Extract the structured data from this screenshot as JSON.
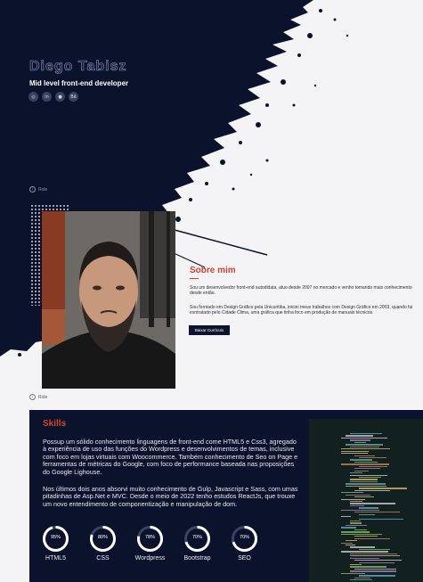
{
  "hero": {
    "name": "Diego Tabisz",
    "role": "Mid level front-end developer",
    "socials": [
      {
        "icon": "instagram-icon",
        "glyph": "◎"
      },
      {
        "icon": "linkedin-icon",
        "glyph": "in"
      },
      {
        "icon": "github-icon",
        "glyph": "●"
      },
      {
        "icon": "behance-icon",
        "glyph": "Bē"
      }
    ],
    "scroll_label": "Role",
    "scroll_glyph": "↓"
  },
  "about": {
    "title": "Sobre mim",
    "paragraph_1": "Sou um desenvolvedor front-end autodidata, atuo desde 2007 no mercado e venho tomando mais conhecimento desde então.",
    "paragraph_2": "Sou formado em Design Gráfico pela Unicuritiba, iniciei meus trabalhos com Design Gráfico em 2003, quando fui contratado pelo Cidade Clima, uma gráfica que tinha foco em produção de manuais técnicos.",
    "cv_button": "Baixar Currículo",
    "scroll_label": "Role",
    "scroll_glyph": "↓"
  },
  "skills": {
    "title": "Skills",
    "paragraph_1": "Possup um sólido conhecimento linguagens de front-end come HTML5 e Css3, agregado à experiência de uso das funções do Wordpress e desenvolvimentos de temas, inclusive com foco em lojas virtuais com Woocommerce. Também conhecimento de Seo on Page e ferramentas de métricas do Google, com foco de performance baseada nas proposições do Google Lighouse.",
    "paragraph_2": "Nos últimos dois anos absorvi muito conhecimento de Gulp, Javascript e Sass, com umas pitadinhas de Asp.Net e MVC. Desde o meio de 2022 tenho estudos ReactJs, que trouxe um novo entendimento de componentização e manipulação de dom.",
    "gauges": [
      {
        "name": "HTML5",
        "label": "95%",
        "value": 0.95
      },
      {
        "name": "CSS",
        "label": "80%",
        "value": 0.8
      },
      {
        "name": "Wordpress",
        "label": "78%",
        "value": 0.78
      },
      {
        "name": "Bootstrap",
        "label": "70%",
        "value": 0.7
      },
      {
        "name": "SEO",
        "label": "70%",
        "value": 0.7
      }
    ]
  },
  "colors": {
    "navy": "#0b122b",
    "accent": "#d8412e",
    "gauge_track": "#3b4361",
    "gauge_fill": "#ffffff"
  }
}
